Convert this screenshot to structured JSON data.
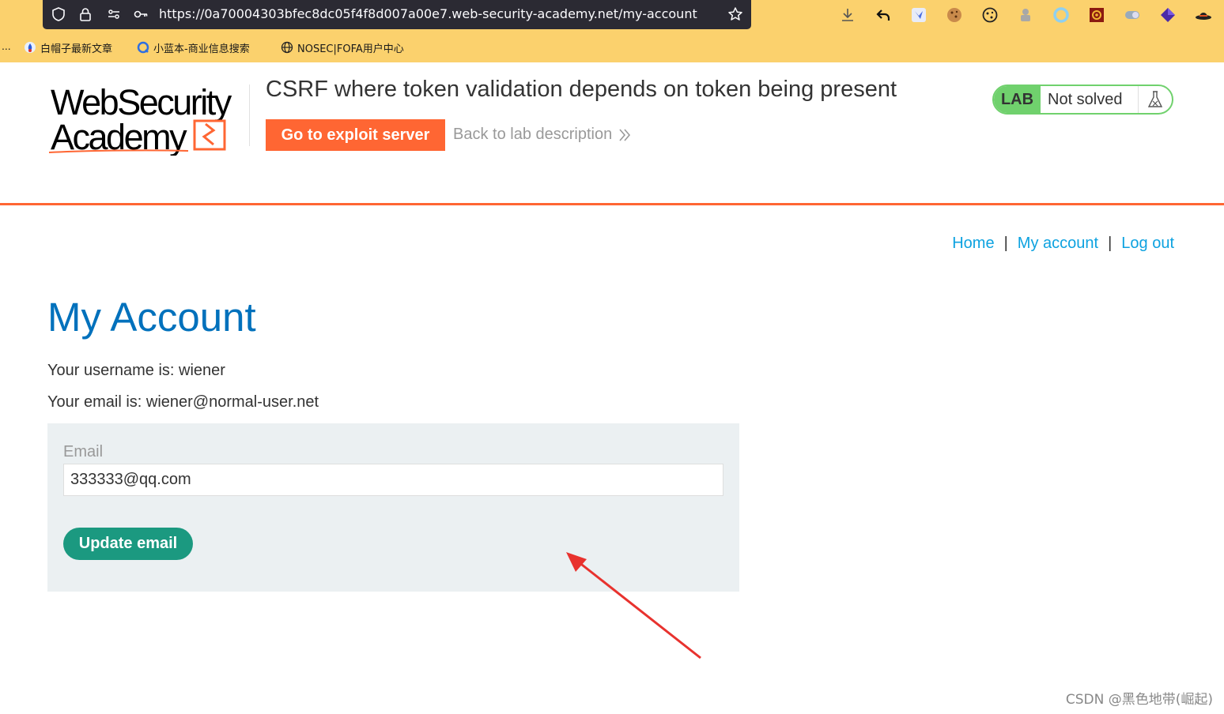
{
  "browser": {
    "url": "https://0a70004303bfec8dc05f4f8d007a00e7.web-security-academy.net/my-account",
    "bookmarks_overflow": "...",
    "bookmarks": [
      {
        "label": "白帽子最新文章",
        "icon": "bookmark-favicon-1"
      },
      {
        "label": "小蓝本-商业信息搜索",
        "icon": "bookmark-favicon-2"
      },
      {
        "label": "NOSEC|FOFA用户中心",
        "icon": "globe-icon"
      }
    ],
    "toolbar_icons": [
      "download-icon",
      "back-arrow-icon",
      "extension-icon",
      "cookie-icon",
      "cookie-editor-icon",
      "puzzle-icon",
      "circle-extension-icon",
      "gear-extension-icon",
      "toggle-extension-icon",
      "diamond-extension-icon",
      "hat-extension-icon"
    ]
  },
  "lab": {
    "logo_line1": "WebSecurity",
    "logo_line2": "Academy",
    "title": "CSRF where token validation depends on token being present",
    "exploit_button": "Go to exploit server",
    "back_link": "Back to lab description",
    "status_tag": "LAB",
    "status_text": "Not solved"
  },
  "nav": {
    "home": "Home",
    "my_account": "My account",
    "log_out": "Log out",
    "separator": "|"
  },
  "page": {
    "title": "My Account",
    "username_text": "Your username is: wiener",
    "email_text": "Your email is: wiener@normal-user.net"
  },
  "form": {
    "email_label": "Email",
    "email_value": "333333@qq.com",
    "submit_label": "Update email"
  },
  "colors": {
    "accent": "#ff6633",
    "link": "#0da2e0",
    "title": "#0071bc",
    "lab_green": "#70d16d",
    "button_green": "#1b9980",
    "browser_chrome": "#fbd16d"
  },
  "watermark": "CSDN @黑色地带(崛起)"
}
